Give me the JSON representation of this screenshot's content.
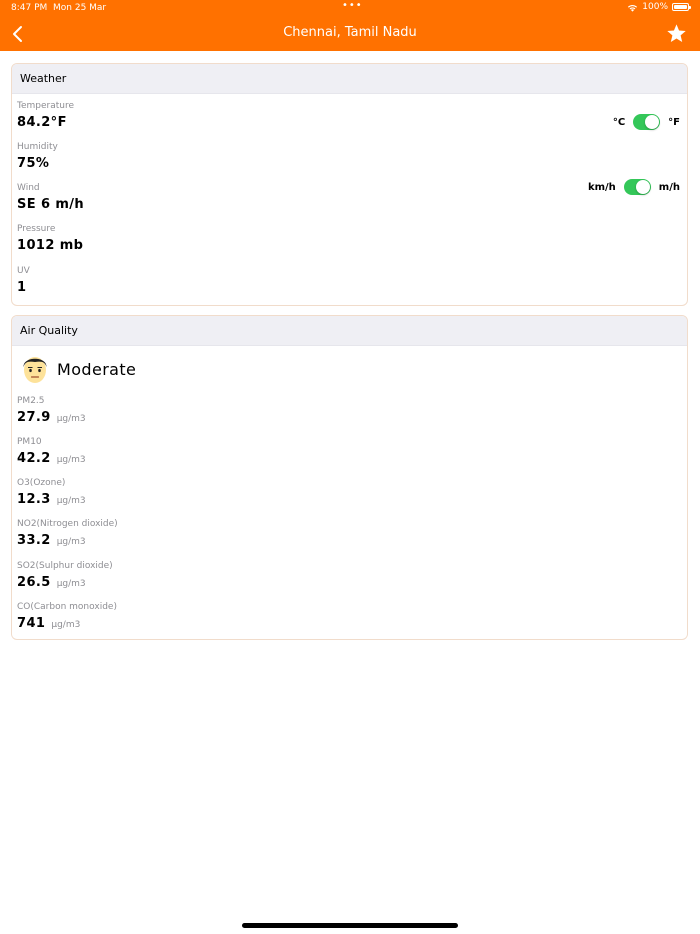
{
  "status_bar": {
    "time": "8:47 PM",
    "date": "Mon 25 Mar",
    "dots": "•••",
    "battery": "100%"
  },
  "nav": {
    "title": "Chennai, Tamil Nadu",
    "back_icon": "chevron-left-icon",
    "favorite_icon": "star-icon"
  },
  "weather": {
    "header": "Weather",
    "temperature": {
      "label": "Temperature",
      "value": "84.2°F"
    },
    "humidity": {
      "label": "Humidity",
      "value": "75%"
    },
    "wind": {
      "label": "Wind",
      "value": "SE 6 m/h"
    },
    "pressure": {
      "label": "Pressure",
      "value": "1012 mb"
    },
    "uv": {
      "label": "UV",
      "value": "1"
    },
    "temp_toggle": {
      "left": "°C",
      "right": "°F",
      "on": true
    },
    "speed_toggle": {
      "left": "km/h",
      "right": "m/h",
      "on": true
    }
  },
  "air_quality": {
    "header": "Air Quality",
    "status": "Moderate",
    "status_icon": "neutral-face-icon",
    "pollutants": [
      {
        "label": "PM2.5",
        "value": "27.9",
        "unit": "µg/m3"
      },
      {
        "label": "PM10",
        "value": "42.2",
        "unit": "µg/m3"
      },
      {
        "label": "O3(Ozone)",
        "value": "12.3",
        "unit": "µg/m3"
      },
      {
        "label": "NO2(Nitrogen dioxide)",
        "value": "33.2",
        "unit": "µg/m3"
      },
      {
        "label": "SO2(Sulphur dioxide)",
        "value": "26.5",
        "unit": "µg/m3"
      },
      {
        "label": "CO(Carbon monoxide)",
        "value": "741",
        "unit": "µg/m3"
      }
    ]
  },
  "colors": {
    "accent": "#ff7100",
    "switch_on": "#34c759",
    "card_header_bg": "#efeff4",
    "label_gray": "#8e8e93"
  }
}
